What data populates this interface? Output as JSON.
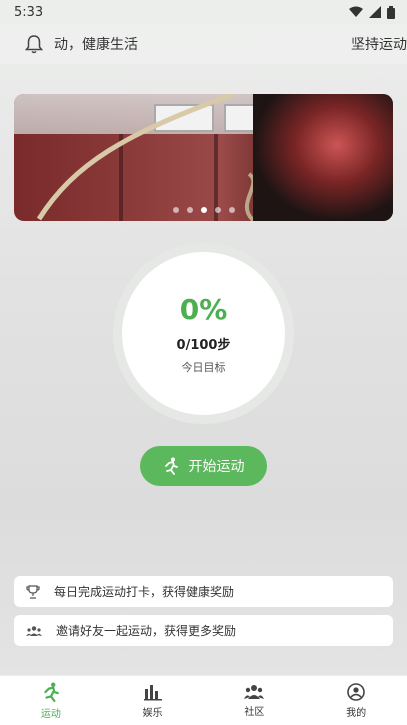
{
  "status": {
    "time": "5:33"
  },
  "header": {
    "ticker_left": "动，健康生活",
    "ticker_right": "坚持运动"
  },
  "banner": {
    "slides": 5,
    "active_slide": 3
  },
  "progress": {
    "percent": "0%",
    "steps": "0/100步",
    "label": "今日目标",
    "fraction": 0
  },
  "actions": {
    "start_label": "开始运动"
  },
  "tips": [
    {
      "text": "每日完成运动打卡，获得健康奖励",
      "icon": "trophy-icon"
    },
    {
      "text": "邀请好友一起运动，获得更多奖励",
      "icon": "people-icon"
    }
  ],
  "tabs": [
    {
      "label": "运动",
      "icon": "running-icon",
      "active": true
    },
    {
      "label": "娱乐",
      "icon": "bar-chart-icon",
      "active": false
    },
    {
      "label": "社区",
      "icon": "group-icon",
      "active": false
    },
    {
      "label": "我的",
      "icon": "profile-icon",
      "active": false
    }
  ],
  "colors": {
    "accent": "#4caf50",
    "button": "#5cb85c"
  }
}
